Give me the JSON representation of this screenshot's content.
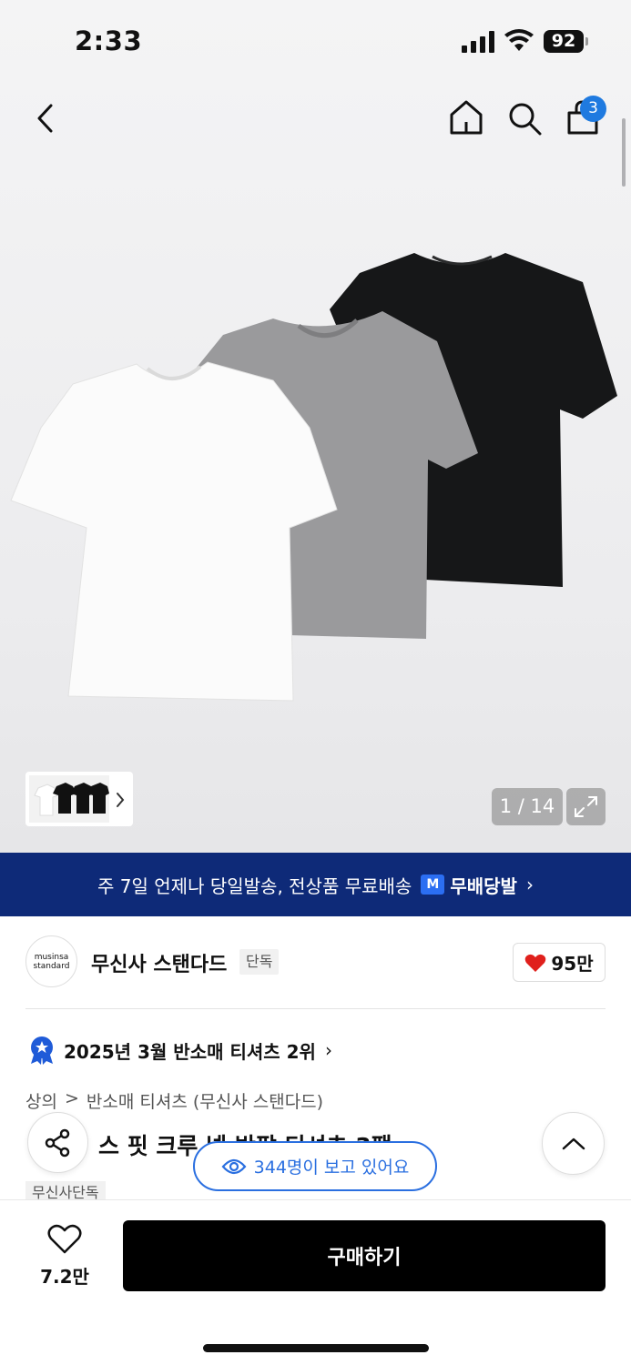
{
  "status_bar": {
    "time": "2:33",
    "battery": "92"
  },
  "header": {
    "cart_count": "3"
  },
  "gallery": {
    "page_counter": "1 / 14"
  },
  "shipping_banner": {
    "text": "주 7일 언제나 당일발송, 전상품 무료배송",
    "brand_mark": "M",
    "brand": "무배당발",
    "arrow": "›"
  },
  "brand": {
    "logo_line1": "musinsa",
    "logo_line2": "standard",
    "name": "무신사 스탠다드",
    "tag": "단독",
    "likes": "95만"
  },
  "ranking": {
    "text": "2025년 3월 반소매 티셔츠 2위",
    "arrow": "›"
  },
  "breadcrumb": {
    "category": "상의",
    "separator": ">",
    "subcategory": "반소매 티셔츠 (무신사 스탠다드)"
  },
  "product": {
    "title_visible": "스 핏 크루 넥 반팔 티셔츠 3팩",
    "exclusive_tag": "무신사단독"
  },
  "viewers": {
    "text": "344명이 보고 있어요"
  },
  "bottom_bar": {
    "wish_count": "7.2만",
    "buy_label": "구매하기"
  },
  "colors": {
    "accent_blue": "#2a6fe0",
    "banner_navy": "#0e2a78",
    "badge_blue": "#1f7ae0",
    "heart_red": "#e0201c"
  }
}
